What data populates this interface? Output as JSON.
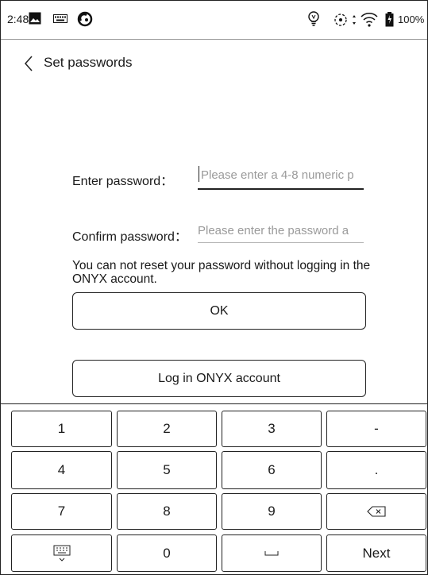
{
  "status_bar": {
    "time": "2:48",
    "battery": "100%",
    "icons": [
      "image-icon",
      "keyboard-status-icon",
      "sync-status-icon",
      "light-bulb-icon",
      "rotate-icon",
      "wifi-icon",
      "battery-icon"
    ]
  },
  "header": {
    "title": "Set passwords"
  },
  "form": {
    "password_label": "Enter password：",
    "password_placeholder": "Please enter a 4-8 numeric p",
    "confirm_label": "Confirm password：",
    "confirm_placeholder": "Please enter the password a",
    "notice": "You can not reset your password without logging in the ONYX account.",
    "ok_label": "OK",
    "login_label": "Log in ONYX account"
  },
  "keyboard": {
    "row1": [
      "1",
      "2",
      "3",
      "-"
    ],
    "row2": [
      "4",
      "5",
      "6",
      "."
    ],
    "row3": [
      "7",
      "8",
      "9"
    ],
    "row4_zero": "0",
    "next_label": "Next"
  }
}
